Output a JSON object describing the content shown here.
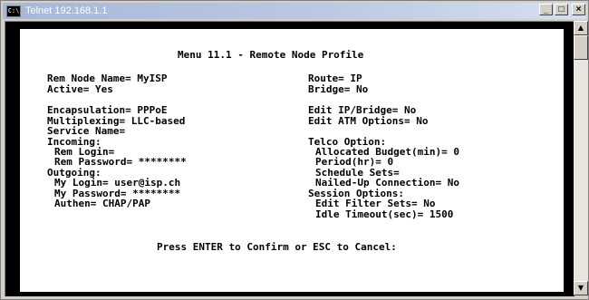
{
  "window": {
    "title": "Telnet 192.168.1.1",
    "icon_text": "C:\\",
    "minimize_glyph": "_",
    "maximize_glyph": "□",
    "close_glyph": "×"
  },
  "scrollbar": {
    "up_glyph": "▲",
    "down_glyph": "▼"
  },
  "menu": {
    "title": "Menu 11.1 - Remote Node Profile",
    "rem_node_name": "Rem Node Name= MyISP",
    "active": "Active= Yes",
    "encapsulation": "Encapsulation= PPPoE",
    "multiplexing": "Multiplexing= LLC-based",
    "service_name": "Service Name=",
    "incoming": "Incoming:",
    "rem_login": "Rem Login=",
    "rem_password": "Rem Password= ********",
    "outgoing": "Outgoing:",
    "my_login": "My Login= user@isp.ch",
    "my_password": "My Password= ********",
    "authen": "Authen= CHAP/PAP",
    "route": "Route= IP",
    "bridge": "Bridge= No",
    "edit_ip_bridge": "Edit IP/Bridge= No",
    "edit_atm": "Edit ATM Options= No",
    "telco_option": "Telco Option:",
    "allocated_budget": "Allocated Budget(min)= 0",
    "period": "Period(hr)= 0",
    "schedule_sets": "Schedule Sets=",
    "nailed_up": "Nailed-Up Connection= No",
    "session_options": "Session Options:",
    "edit_filter_sets": "Edit Filter Sets= No",
    "idle_timeout": "Idle Timeout(sec)= 1500",
    "prompt": "Press ENTER to Confirm or ESC to Cancel:"
  }
}
